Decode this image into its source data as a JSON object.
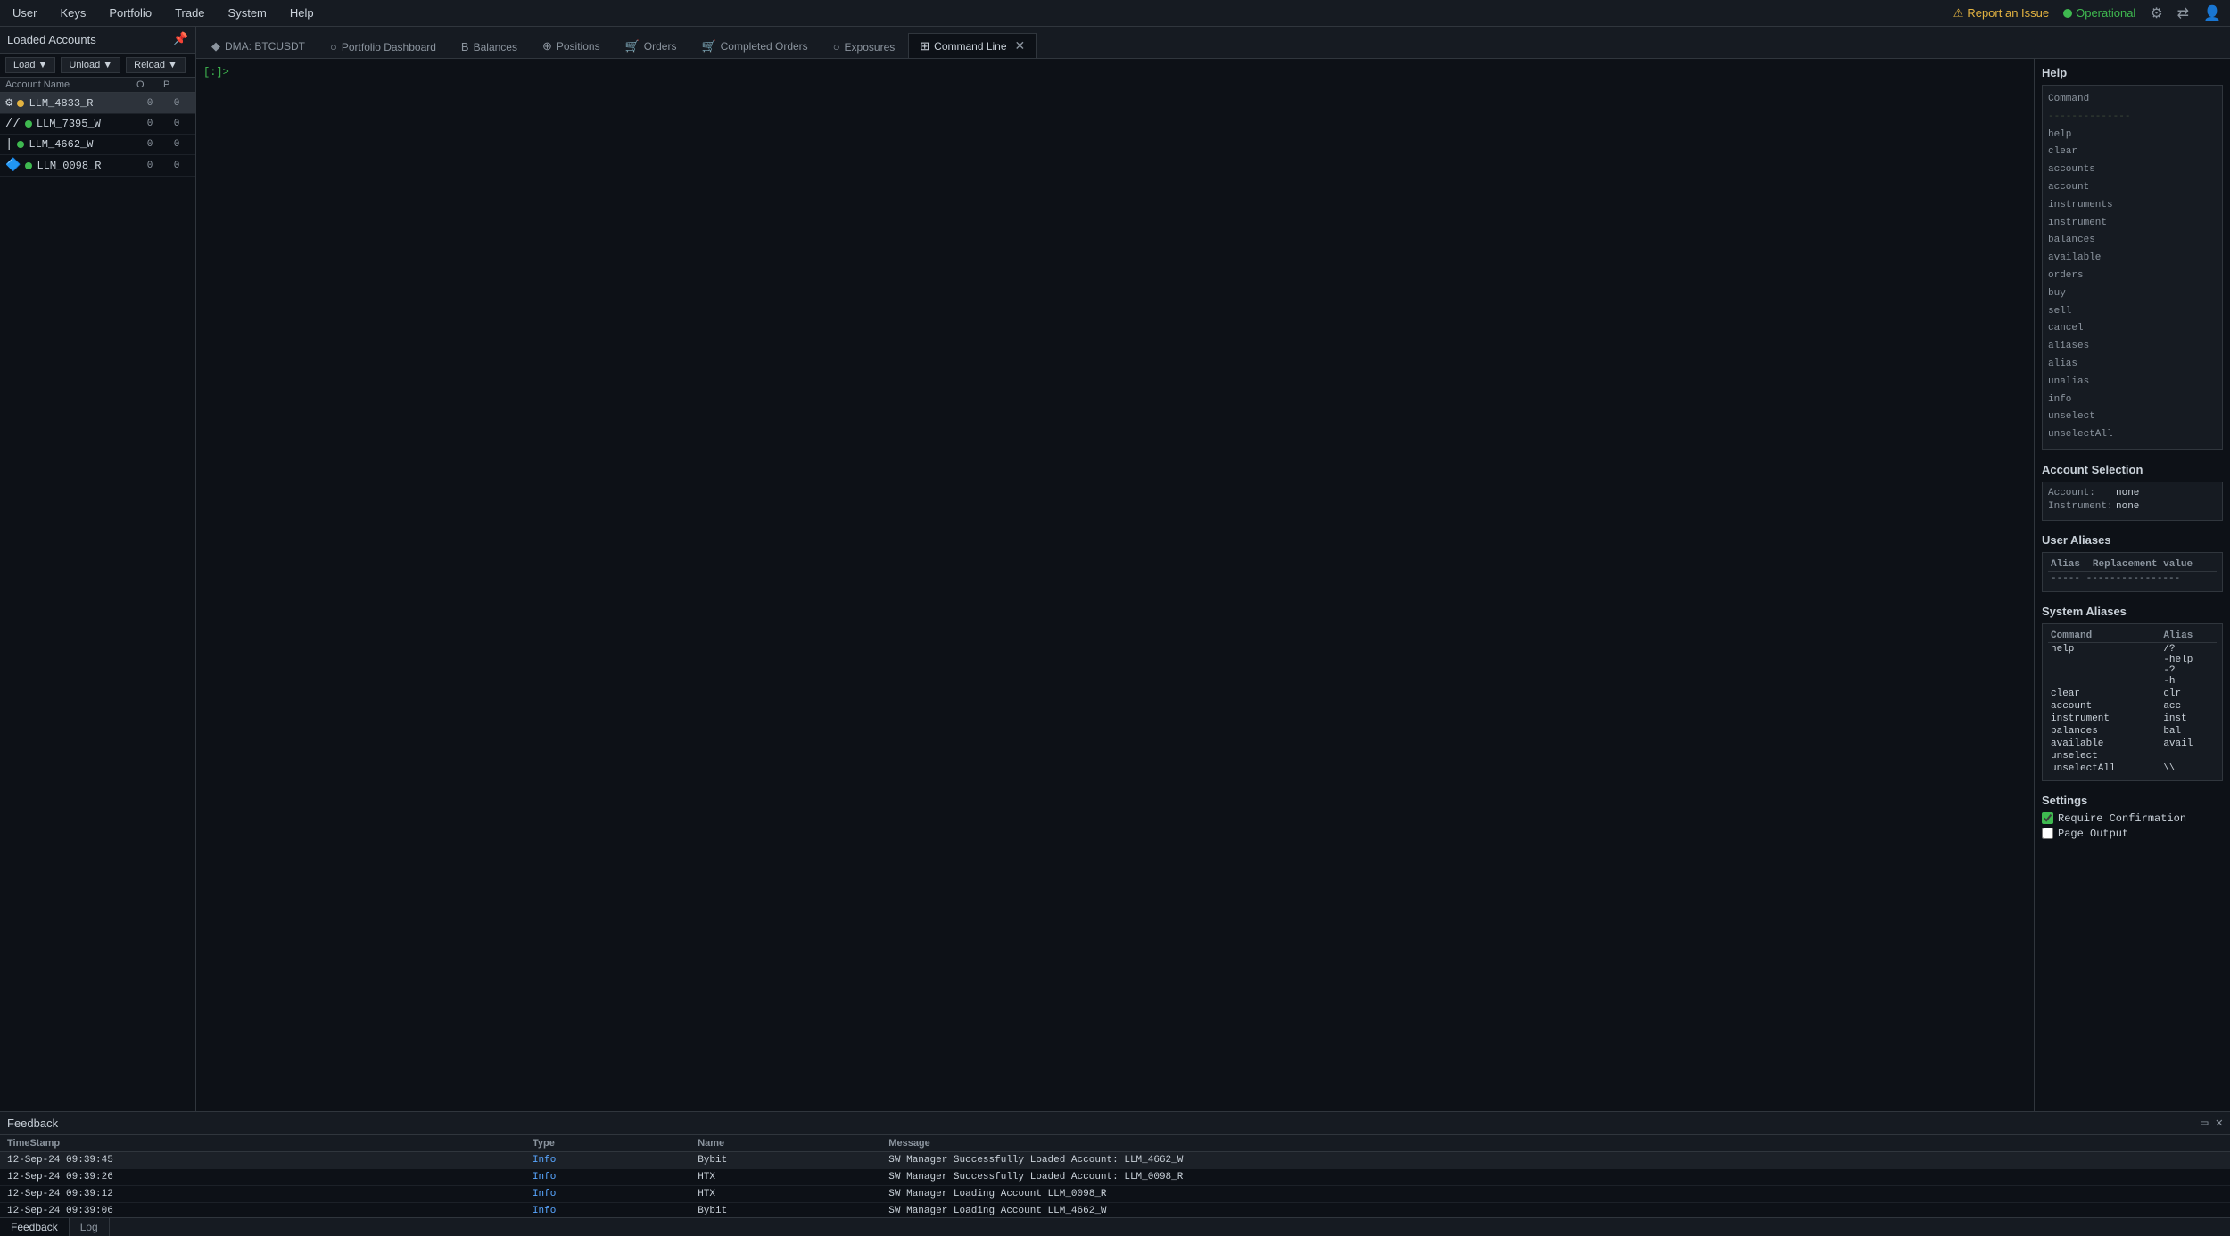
{
  "menuBar": {
    "items": [
      "User",
      "Keys",
      "Portfolio",
      "Trade",
      "System",
      "Help"
    ],
    "reportIssue": "Report an Issue",
    "operational": "Operational",
    "icons": [
      "gear-icon",
      "network-icon",
      "user-icon"
    ]
  },
  "sidebar": {
    "title": "Loaded Accounts",
    "pinIcon": "📌",
    "controls": {
      "load": "Load",
      "unload": "Unload",
      "reload": "Reload"
    },
    "tableHeaders": {
      "name": "Account Name",
      "o": "O",
      "p": "P"
    },
    "accounts": [
      {
        "id": "LLM_4833_R",
        "icon": "⚙",
        "statusColor": "dot-orange",
        "o": 0,
        "p": 0,
        "selected": true
      },
      {
        "id": "LLM_7395_W",
        "icon": "//",
        "statusColor": "dot-green",
        "o": 0,
        "p": 0,
        "selected": false
      },
      {
        "id": "LLM_4662_W",
        "icon": "|",
        "statusColor": "dot-green",
        "o": 0,
        "p": 0,
        "selected": false
      },
      {
        "id": "LLM_0098_R",
        "icon": "🔷",
        "statusColor": "dot-green",
        "o": 0,
        "p": 0,
        "selected": false
      }
    ]
  },
  "tabs": [
    {
      "id": "dma",
      "icon": "◆",
      "label": "DMA: BTCUSDT",
      "closable": false,
      "active": false
    },
    {
      "id": "portfolio",
      "icon": "○",
      "label": "Portfolio Dashboard",
      "closable": false,
      "active": false
    },
    {
      "id": "balances",
      "icon": "B",
      "label": "Balances",
      "closable": false,
      "active": false
    },
    {
      "id": "positions",
      "icon": "⊕",
      "label": "Positions",
      "closable": false,
      "active": false
    },
    {
      "id": "orders",
      "icon": "🛒",
      "label": "Orders",
      "closable": false,
      "active": false
    },
    {
      "id": "completed",
      "icon": "🛒",
      "label": "Completed Orders",
      "closable": false,
      "active": false
    },
    {
      "id": "exposures",
      "icon": "○",
      "label": "Exposures",
      "closable": false,
      "active": false
    },
    {
      "id": "cmdline",
      "icon": "⊞",
      "label": "Command Line",
      "closable": true,
      "active": true
    }
  ],
  "commandLine": {
    "prompt": "[:]>",
    "output": ""
  },
  "helpPanel": {
    "title": "Help",
    "commands": [
      "Command",
      "--------------",
      "help",
      "clear",
      "accounts",
      "account",
      "instruments",
      "instrument",
      "balances",
      "available",
      "orders",
      "buy",
      "sell",
      "cancel",
      "aliases",
      "alias",
      "unalias",
      "info",
      "unselect",
      "unselectAll"
    ]
  },
  "accountSelection": {
    "title": "Account Selection",
    "accountLabel": "Account:",
    "accountValue": "none",
    "instrumentLabel": "Instrument:",
    "instrumentValue": "none"
  },
  "userAliases": {
    "title": "User Aliases",
    "headers": [
      "Alias",
      "Replacement value"
    ],
    "separator": "----- ----------------",
    "rows": []
  },
  "systemAliases": {
    "title": "System Aliases",
    "headers": [
      "Command",
      "Alias"
    ],
    "rows": [
      {
        "command": "Command",
        "alias": "Alias"
      },
      {
        "command": "------",
        "alias": "------"
      },
      {
        "command": "help",
        "alias": "/?\\n-help\\n-?\\n-h"
      },
      {
        "command": "clear",
        "alias": "clr"
      },
      {
        "command": "account",
        "alias": "acc"
      },
      {
        "command": "instrument",
        "alias": "inst"
      },
      {
        "command": "balances",
        "alias": "bal"
      },
      {
        "command": "available",
        "alias": "avail"
      },
      {
        "command": "unselect",
        "alias": ""
      },
      {
        "command": "unselectAll",
        "alias": "\\\\"
      }
    ]
  },
  "settings": {
    "title": "Settings",
    "requireConfirmation": true,
    "requireConfirmationLabel": "Require Confirmation",
    "pageOutput": false,
    "pageOutputLabel": "Page Output"
  },
  "feedback": {
    "title": "Feedback",
    "tabs": [
      "Feedback",
      "Log"
    ],
    "activeTab": "Feedback",
    "columns": [
      "TimeStamp",
      "Type",
      "Name",
      "Message"
    ],
    "rows": [
      {
        "timestamp": "12-Sep-24 09:39:45",
        "type": "Info",
        "name": "Bybit",
        "message": "SW Manager Successfully Loaded Account: LLM_4662_W",
        "highlight": true
      },
      {
        "timestamp": "12-Sep-24 09:39:26",
        "type": "Info",
        "name": "HTX",
        "message": "SW Manager Successfully Loaded Account: LLM_0098_R",
        "highlight": false
      },
      {
        "timestamp": "12-Sep-24 09:39:12",
        "type": "Info",
        "name": "HTX",
        "message": "SW Manager Loading Account LLM_0098_R",
        "highlight": false
      },
      {
        "timestamp": "12-Sep-24 09:39:06",
        "type": "Info",
        "name": "Bybit",
        "message": "SW Manager Loading Account LLM_4662_W",
        "highlight": false
      }
    ]
  }
}
